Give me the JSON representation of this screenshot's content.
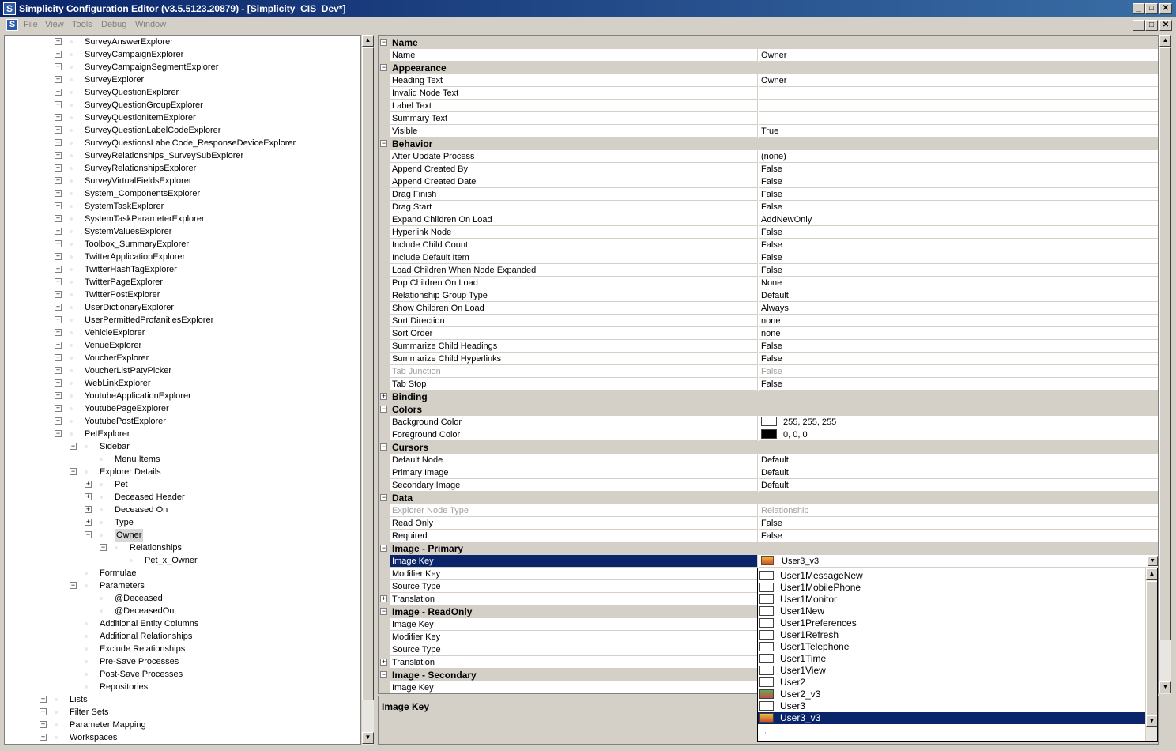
{
  "window": {
    "title": "Simplicity Configuration Editor (v3.5.5123.20879) - [Simplicity_CIS_Dev*]",
    "app_icon": "S",
    "minimize": "_",
    "restore": "□",
    "close": "✕"
  },
  "menu": {
    "icon": "S",
    "items": [
      "File",
      "View",
      "Tools",
      "Debug",
      "Window"
    ]
  },
  "tree": {
    "explorers": [
      "SurveyAnswerExplorer",
      "SurveyCampaignExplorer",
      "SurveyCampaignSegmentExplorer",
      "SurveyExplorer",
      "SurveyQuestionExplorer",
      "SurveyQuestionGroupExplorer",
      "SurveyQuestionItemExplorer",
      "SurveyQuestionLabelCodeExplorer",
      "SurveyQuestionsLabelCode_ResponseDeviceExplorer",
      "SurveyRelationships_SurveySubExplorer",
      "SurveyRelationshipsExplorer",
      "SurveyVirtualFieldsExplorer",
      "System_ComponentsExplorer",
      "SystemTaskExplorer",
      "SystemTaskParameterExplorer",
      "SystemValuesExplorer",
      "Toolbox_SummaryExplorer",
      "TwitterApplicationExplorer",
      "TwitterHashTagExplorer",
      "TwitterPageExplorer",
      "TwitterPostExplorer",
      "UserDictionaryExplorer",
      "UserPermittedProfanitiesExplorer",
      "VehicleExplorer",
      "VenueExplorer",
      "VoucherExplorer",
      "VoucherListPatyPicker",
      "WebLinkExplorer",
      "YoutubeApplicationExplorer",
      "YoutubePageExplorer",
      "YoutubePostExplorer"
    ],
    "pet_explorer": "PetExplorer",
    "sidebar": "Sidebar",
    "menu_items": "Menu Items",
    "explorer_details": "Explorer Details",
    "details": [
      "Pet",
      "Deceased Header",
      "Deceased On",
      "Type"
    ],
    "owner": "Owner",
    "relationships": "Relationships",
    "pet_x_owner": "Pet_x_Owner",
    "formulae": "Formulae",
    "parameters": "Parameters",
    "params": [
      "@Deceased",
      "@DeceasedOn"
    ],
    "other": [
      "Additional Entity Columns",
      "Additional Relationships",
      "Exclude Relationships",
      "Pre-Save Processes",
      "Post-Save Processes",
      "Repositories"
    ],
    "roots": [
      "Lists",
      "Filter Sets",
      "Parameter Mapping",
      "Workspaces"
    ]
  },
  "grid": {
    "rows": [
      {
        "type": "cat",
        "label": "Name",
        "exp": "−"
      },
      {
        "type": "prop",
        "name": "Name",
        "value": "Owner"
      },
      {
        "type": "cat",
        "label": "Appearance",
        "exp": "−"
      },
      {
        "type": "prop",
        "name": "Heading Text",
        "value": "Owner"
      },
      {
        "type": "prop",
        "name": "Invalid Node Text",
        "value": ""
      },
      {
        "type": "prop",
        "name": "Label Text",
        "value": ""
      },
      {
        "type": "prop",
        "name": "Summary Text",
        "value": ""
      },
      {
        "type": "prop",
        "name": "Visible",
        "value": "True"
      },
      {
        "type": "cat",
        "label": "Behavior",
        "exp": "−"
      },
      {
        "type": "prop",
        "name": "After Update Process",
        "value": "(none)"
      },
      {
        "type": "prop",
        "name": "Append Created By",
        "value": "False"
      },
      {
        "type": "prop",
        "name": "Append Created Date",
        "value": "False"
      },
      {
        "type": "prop",
        "name": "Drag Finish",
        "value": "False"
      },
      {
        "type": "prop",
        "name": "Drag Start",
        "value": "False"
      },
      {
        "type": "prop",
        "name": "Expand Children On Load",
        "value": "AddNewOnly"
      },
      {
        "type": "prop",
        "name": "Hyperlink Node",
        "value": "False"
      },
      {
        "type": "prop",
        "name": "Include Child Count",
        "value": "False"
      },
      {
        "type": "prop",
        "name": "Include Default Item",
        "value": "False"
      },
      {
        "type": "prop",
        "name": "Load Children When Node Expanded",
        "value": "False"
      },
      {
        "type": "prop",
        "name": "Pop Children On Load",
        "value": "None"
      },
      {
        "type": "prop",
        "name": "Relationship Group Type",
        "value": "Default"
      },
      {
        "type": "prop",
        "name": "Show Children On Load",
        "value": "Always"
      },
      {
        "type": "prop",
        "name": "Sort Direction",
        "value": "none"
      },
      {
        "type": "prop",
        "name": "Sort Order",
        "value": "none"
      },
      {
        "type": "prop",
        "name": "Summarize Child Headings",
        "value": "False"
      },
      {
        "type": "prop",
        "name": "Summarize Child Hyperlinks",
        "value": "False"
      },
      {
        "type": "prop",
        "name": "Tab Junction",
        "value": "False",
        "disabled": true
      },
      {
        "type": "prop",
        "name": "Tab Stop",
        "value": "False"
      },
      {
        "type": "cat",
        "label": "Binding",
        "exp": "+"
      },
      {
        "type": "cat",
        "label": "Colors",
        "exp": "−"
      },
      {
        "type": "prop",
        "name": "Background Color",
        "value": "255, 255, 255",
        "swatch": "#ffffff"
      },
      {
        "type": "prop",
        "name": "Foreground Color",
        "value": "0, 0, 0",
        "swatch": "#000000"
      },
      {
        "type": "cat",
        "label": "Cursors",
        "exp": "−"
      },
      {
        "type": "prop",
        "name": "Default Node",
        "value": "Default"
      },
      {
        "type": "prop",
        "name": "Primary Image",
        "value": "Default"
      },
      {
        "type": "prop",
        "name": "Secondary Image",
        "value": "Default"
      },
      {
        "type": "cat",
        "label": "Data",
        "exp": "−"
      },
      {
        "type": "prop",
        "name": "Explorer Node Type",
        "value": "Relationship",
        "disabled": true
      },
      {
        "type": "prop",
        "name": "Read Only",
        "value": "False"
      },
      {
        "type": "prop",
        "name": "Required",
        "value": "False"
      },
      {
        "type": "cat",
        "label": "Image - Primary",
        "exp": "−"
      },
      {
        "type": "prop",
        "name": "Image Key",
        "value": "User3_v3",
        "selected": true,
        "icon": true
      },
      {
        "type": "prop",
        "name": "Modifier Key",
        "value": ""
      },
      {
        "type": "prop",
        "name": "Source Type",
        "value": ""
      },
      {
        "type": "prop",
        "name": "Translation",
        "value": "",
        "sub": true
      },
      {
        "type": "cat",
        "label": "Image - ReadOnly",
        "exp": "−"
      },
      {
        "type": "prop",
        "name": "Image Key",
        "value": ""
      },
      {
        "type": "prop",
        "name": "Modifier Key",
        "value": ""
      },
      {
        "type": "prop",
        "name": "Source Type",
        "value": ""
      },
      {
        "type": "prop",
        "name": "Translation",
        "value": "",
        "sub": true
      },
      {
        "type": "cat",
        "label": "Image - Secondary",
        "exp": "−"
      },
      {
        "type": "prop",
        "name": "Image Key",
        "value": ""
      }
    ]
  },
  "help": {
    "title": "Image Key"
  },
  "dropdown": {
    "items": [
      {
        "label": "User1MessageNew"
      },
      {
        "label": "User1MobilePhone"
      },
      {
        "label": "User1Monitor"
      },
      {
        "label": "User1New"
      },
      {
        "label": "User1Preferences"
      },
      {
        "label": "User1Refresh"
      },
      {
        "label": "User1Telephone"
      },
      {
        "label": "User1Time"
      },
      {
        "label": "User1View"
      },
      {
        "label": "User2"
      },
      {
        "label": "User2_v3",
        "img": "img1"
      },
      {
        "label": "User3"
      },
      {
        "label": "User3_v3",
        "img": "img2",
        "selected": true
      }
    ]
  }
}
